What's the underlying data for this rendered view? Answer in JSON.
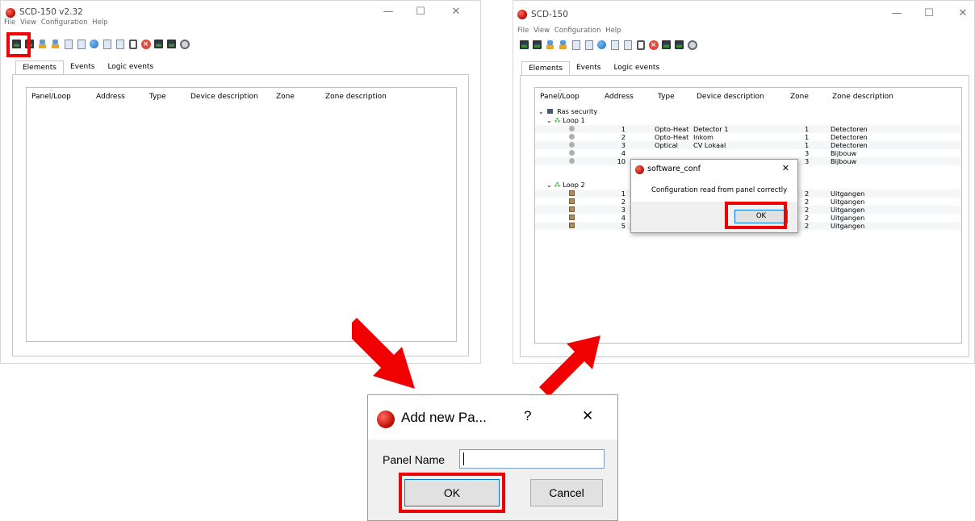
{
  "left_window": {
    "title": "SCD-150 v2.32",
    "menu": [
      "File",
      "View",
      "Configuration",
      "Help"
    ],
    "tabs": [
      "Elements",
      "Events",
      "Logic events"
    ],
    "columns": [
      "Panel/Loop",
      "Address",
      "Type",
      "Device description",
      "Zone",
      "Zone description"
    ]
  },
  "right_window": {
    "title": "SCD-150",
    "menu": [
      "File",
      "View",
      "Configuration",
      "Help"
    ],
    "tabs": [
      "Elements",
      "Events",
      "Logic events"
    ],
    "columns": [
      "Panel/Loop",
      "Address",
      "Type",
      "Device description",
      "Zone",
      "Zone description"
    ],
    "panel_name": "Ras security",
    "loop1": {
      "label": "Loop 1",
      "rows": [
        {
          "address": "1",
          "type": "Opto-Heat",
          "desc": "Detector  1",
          "zone": "1",
          "zone_desc": "Detectoren"
        },
        {
          "address": "2",
          "type": "Opto-Heat",
          "desc": "Inkom",
          "zone": "1",
          "zone_desc": "Detectoren"
        },
        {
          "address": "3",
          "type": "Optical",
          "desc": "CV Lokaal",
          "zone": "1",
          "zone_desc": "Detectoren"
        },
        {
          "address": "4",
          "type": "",
          "desc": "",
          "zone": "3",
          "zone_desc": "Bijbouw"
        },
        {
          "address": "10",
          "type": "",
          "desc": "",
          "zone": "3",
          "zone_desc": "Bijbouw"
        }
      ]
    },
    "loop2": {
      "label": "Loop 2",
      "rows": [
        {
          "address": "1",
          "type": "",
          "desc": "",
          "zone": "2",
          "zone_desc": "Uitgangen"
        },
        {
          "address": "2",
          "type": "",
          "desc": "",
          "zone": "2",
          "zone_desc": "Uitgangen"
        },
        {
          "address": "3",
          "type": "",
          "desc": "",
          "zone": "2",
          "zone_desc": "Uitgangen"
        },
        {
          "address": "4",
          "type": "",
          "desc": "",
          "zone": "2",
          "zone_desc": "Uitgangen"
        },
        {
          "address": "5",
          "type": "Output",
          "desc": "Vrij",
          "zone": "2",
          "zone_desc": "Uitgangen"
        }
      ]
    }
  },
  "message_box": {
    "title": "software_conf",
    "message": "Configuration read from panel correctly",
    "ok_label": "OK",
    "close_glyph": "✕"
  },
  "add_panel_dialog": {
    "title": "Add new Pa...",
    "help_glyph": "?",
    "close_glyph": "✕",
    "field_label": "Panel Name",
    "field_value": "",
    "ok_label": "OK",
    "cancel_label": "Cancel"
  },
  "window_controls": {
    "minimize": "—",
    "maximize": "☐",
    "close": "✕"
  },
  "colors": {
    "highlight": "#f00000",
    "app_icon": "#c3150c"
  }
}
